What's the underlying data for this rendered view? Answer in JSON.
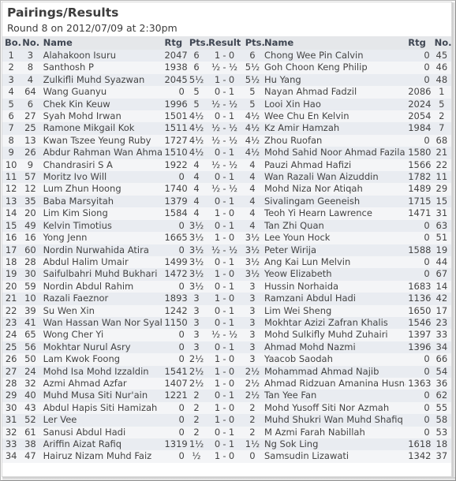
{
  "header": {
    "title": "Pairings/Results",
    "subtitle": "Round 8 on 2012/07/09 at 2:30pm"
  },
  "columns": {
    "board": "Bo.",
    "number_white": "No.",
    "name_white": "Name",
    "rating_white": "Rtg",
    "points_white": "Pts.",
    "result": "Result",
    "points_black": "Pts.",
    "name_black": "Name",
    "rating_black": "Rtg",
    "number_black": "No."
  },
  "colors": {
    "link": "#2129c4",
    "header_bg": "#e5e7ea",
    "row_odd": "#e9ecf1",
    "row_even": "#f4f5f7",
    "text": "#444444",
    "title": "#3d3d3d"
  },
  "rows": [
    {
      "bo": "1",
      "no1": "3",
      "name1": "Alahakoon Isuru",
      "rtg1": "2047",
      "pts1": "6",
      "result": "1 - 0",
      "pts2": "6",
      "name2": "Chong Wee Pin Calvin",
      "rtg2": "0",
      "no2": "45"
    },
    {
      "bo": "2",
      "no1": "8",
      "name1": "Santhosh P",
      "rtg1": "1938",
      "pts1": "6",
      "result": "½ - ½",
      "pts2": "5½",
      "name2": "Goh Choon Keng Philip",
      "rtg2": "0",
      "no2": "46"
    },
    {
      "bo": "3",
      "no1": "4",
      "name1": "Zulkifli Muhd Syazwan",
      "rtg1": "2045",
      "pts1": "5½",
      "result": "1 - 0",
      "pts2": "5½",
      "name2": "Hu Yang",
      "rtg2": "0",
      "no2": "48"
    },
    {
      "bo": "4",
      "no1": "64",
      "name1": "Wang Guanyu",
      "rtg1": "0",
      "pts1": "5",
      "result": "0 - 1",
      "pts2": "5",
      "name2": "Nayan Ahmad Fadzil",
      "rtg2": "2086",
      "no2": "1"
    },
    {
      "bo": "5",
      "no1": "6",
      "name1": "Chek Kin Keuw",
      "rtg1": "1996",
      "pts1": "5",
      "result": "½ - ½",
      "pts2": "5",
      "name2": "Looi Xin Hao",
      "rtg2": "2024",
      "no2": "5"
    },
    {
      "bo": "6",
      "no1": "27",
      "name1": "Syah Mohd Irwan",
      "rtg1": "1501",
      "pts1": "4½",
      "result": "0 - 1",
      "pts2": "4½",
      "name2": "Wee Chu En Kelvin",
      "rtg2": "2054",
      "no2": "2"
    },
    {
      "bo": "7",
      "no1": "25",
      "name1": "Ramone Mikgail Kok",
      "rtg1": "1511",
      "pts1": "4½",
      "result": "½ - ½",
      "pts2": "4½",
      "name2": "Kz Amir Hamzah",
      "rtg2": "1984",
      "no2": "7"
    },
    {
      "bo": "8",
      "no1": "13",
      "name1": "Kwan Tszee Yeung Ruby",
      "rtg1": "1727",
      "pts1": "4½",
      "result": "½ - ½",
      "pts2": "4½",
      "name2": "Zhou Ruofan",
      "rtg2": "0",
      "no2": "68"
    },
    {
      "bo": "9",
      "no1": "26",
      "name1": "Abdur Rahman Wan Ahmad Farid",
      "rtg1": "1510",
      "pts1": "4½",
      "result": "0 - 1",
      "pts2": "4½",
      "name2": "Mohd Sahid Noor Ahmad Fazilah",
      "rtg2": "1580",
      "no2": "21"
    },
    {
      "bo": "10",
      "no1": "9",
      "name1": "Chandrasiri S A",
      "rtg1": "1922",
      "pts1": "4",
      "result": "½ - ½",
      "pts2": "4",
      "name2": "Pauzi Ahmad Hafizi",
      "rtg2": "1566",
      "no2": "22"
    },
    {
      "bo": "11",
      "no1": "57",
      "name1": "Moritz Ivo Will",
      "rtg1": "0",
      "pts1": "4",
      "result": "0 - 1",
      "pts2": "4",
      "name2": "Wan Razali Wan Aizuddin",
      "rtg2": "1782",
      "no2": "11"
    },
    {
      "bo": "12",
      "no1": "12",
      "name1": "Lum Zhun Hoong",
      "rtg1": "1740",
      "pts1": "4",
      "result": "½ - ½",
      "pts2": "4",
      "name2": "Mohd Niza Nor Atiqah",
      "rtg2": "1489",
      "no2": "29"
    },
    {
      "bo": "13",
      "no1": "35",
      "name1": "Baba Marsyitah",
      "rtg1": "1379",
      "pts1": "4",
      "result": "0 - 1",
      "pts2": "4",
      "name2": "Sivalingam Geeneish",
      "rtg2": "1715",
      "no2": "15"
    },
    {
      "bo": "14",
      "no1": "20",
      "name1": "Lim Kim Siong",
      "rtg1": "1584",
      "pts1": "4",
      "result": "1 - 0",
      "pts2": "4",
      "name2": "Teoh Yi Hearn Lawrence",
      "rtg2": "1471",
      "no2": "31"
    },
    {
      "bo": "15",
      "no1": "49",
      "name1": "Kelvin Timotius",
      "rtg1": "0",
      "pts1": "3½",
      "result": "0 - 1",
      "pts2": "4",
      "name2": "Tan Zhi Quan",
      "rtg2": "0",
      "no2": "63"
    },
    {
      "bo": "16",
      "no1": "16",
      "name1": "Yong Jenn",
      "rtg1": "1665",
      "pts1": "3½",
      "result": "1 - 0",
      "pts2": "3½",
      "name2": "Lee Youn Hock",
      "rtg2": "0",
      "no2": "51"
    },
    {
      "bo": "17",
      "no1": "60",
      "name1": "Nordin Nurwahida Atira",
      "rtg1": "0",
      "pts1": "3½",
      "result": "½ - ½",
      "pts2": "3½",
      "name2": "Peter Wirija",
      "rtg2": "1588",
      "no2": "19"
    },
    {
      "bo": "18",
      "no1": "28",
      "name1": "Abdul Halim Umair",
      "rtg1": "1499",
      "pts1": "3½",
      "result": "0 - 1",
      "pts2": "3½",
      "name2": "Ang Kai Lun Melvin",
      "rtg2": "0",
      "no2": "44"
    },
    {
      "bo": "19",
      "no1": "30",
      "name1": "Saifulbahri Muhd Bukhari",
      "rtg1": "1472",
      "pts1": "3½",
      "result": "1 - 0",
      "pts2": "3½",
      "name2": "Yeow Elizabeth",
      "rtg2": "0",
      "no2": "67"
    },
    {
      "bo": "20",
      "no1": "59",
      "name1": "Nordin Abdul Rahim",
      "rtg1": "0",
      "pts1": "3½",
      "result": "0 - 1",
      "pts2": "3",
      "name2": "Hussin Norhaida",
      "rtg2": "1683",
      "no2": "14"
    },
    {
      "bo": "21",
      "no1": "10",
      "name1": "Razali Faeznor",
      "rtg1": "1893",
      "pts1": "3",
      "result": "1 - 0",
      "pts2": "3",
      "name2": "Ramzani Abdul Hadi",
      "rtg2": "1136",
      "no2": "42"
    },
    {
      "bo": "22",
      "no1": "39",
      "name1": "Su Wen Xin",
      "rtg1": "1242",
      "pts1": "3",
      "result": "0 - 1",
      "pts2": "3",
      "name2": "Lim Wei Sheng",
      "rtg2": "1650",
      "no2": "17"
    },
    {
      "bo": "23",
      "no1": "41",
      "name1": "Wan Hassan Wan Nor Syahirah",
      "rtg1": "1150",
      "pts1": "3",
      "result": "0 - 1",
      "pts2": "3",
      "name2": "Mokhtar Azizi Zafran Khalis",
      "rtg2": "1546",
      "no2": "23"
    },
    {
      "bo": "24",
      "no1": "65",
      "name1": "Wong Cher Yi",
      "rtg1": "0",
      "pts1": "3",
      "result": "½ - ½",
      "pts2": "3",
      "name2": "Mohd Sulkifly Muhd Zuhairi",
      "rtg2": "1397",
      "no2": "33"
    },
    {
      "bo": "25",
      "no1": "56",
      "name1": "Mokhtar Nurul Asry",
      "rtg1": "0",
      "pts1": "3",
      "result": "0 - 1",
      "pts2": "3",
      "name2": "Ahmad Mohd Nazmi",
      "rtg2": "1396",
      "no2": "34"
    },
    {
      "bo": "26",
      "no1": "50",
      "name1": "Lam Kwok Foong",
      "rtg1": "0",
      "pts1": "2½",
      "result": "1 - 0",
      "pts2": "3",
      "name2": "Yaacob Saodah",
      "rtg2": "0",
      "no2": "66"
    },
    {
      "bo": "27",
      "no1": "24",
      "name1": "Mohd Isa Mohd Izzaldin",
      "rtg1": "1541",
      "pts1": "2½",
      "result": "1 - 0",
      "pts2": "2½",
      "name2": "Mohammad Ahmad Najib",
      "rtg2": "0",
      "no2": "54"
    },
    {
      "bo": "28",
      "no1": "32",
      "name1": "Azmi Ahmad Azfar",
      "rtg1": "1407",
      "pts1": "2½",
      "result": "1 - 0",
      "pts2": "2½",
      "name2": "Ahmad Ridzuan Amanina Husna",
      "rtg2": "1363",
      "no2": "36"
    },
    {
      "bo": "29",
      "no1": "40",
      "name1": "Muhd Musa Siti Nur'ain",
      "rtg1": "1221",
      "pts1": "2",
      "result": "0 - 1",
      "pts2": "2½",
      "name2": "Tan Yee Fan",
      "rtg2": "0",
      "no2": "62"
    },
    {
      "bo": "30",
      "no1": "43",
      "name1": "Abdul Hapis Siti Hamizah",
      "rtg1": "0",
      "pts1": "2",
      "result": "1 - 0",
      "pts2": "2",
      "name2": "Mohd Yusoff Siti Nor Azmah",
      "rtg2": "0",
      "no2": "55"
    },
    {
      "bo": "31",
      "no1": "52",
      "name1": "Ler Vee",
      "rtg1": "0",
      "pts1": "2",
      "result": "1 - 0",
      "pts2": "2",
      "name2": "Muhd Shukri Wan Muhd Shafiq",
      "rtg2": "0",
      "no2": "58"
    },
    {
      "bo": "32",
      "no1": "61",
      "name1": "Sanusi Abdul Hadi",
      "rtg1": "0",
      "pts1": "2",
      "result": "0 - 1",
      "pts2": "2",
      "name2": "M Azmi Farah Nabillah",
      "rtg2": "0",
      "no2": "53"
    },
    {
      "bo": "33",
      "no1": "38",
      "name1": "Ariffin Aizat Rafiq",
      "rtg1": "1319",
      "pts1": "1½",
      "result": "0 - 1",
      "pts2": "1½",
      "name2": "Ng Sok Ling",
      "rtg2": "1618",
      "no2": "18"
    },
    {
      "bo": "34",
      "no1": "47",
      "name1": "Hairuz Nizam Muhd Faiz",
      "rtg1": "0",
      "pts1": "½",
      "result": "1 - 0",
      "pts2": "0",
      "name2": "Samsudin Lizawati",
      "rtg2": "1342",
      "no2": "37"
    }
  ]
}
